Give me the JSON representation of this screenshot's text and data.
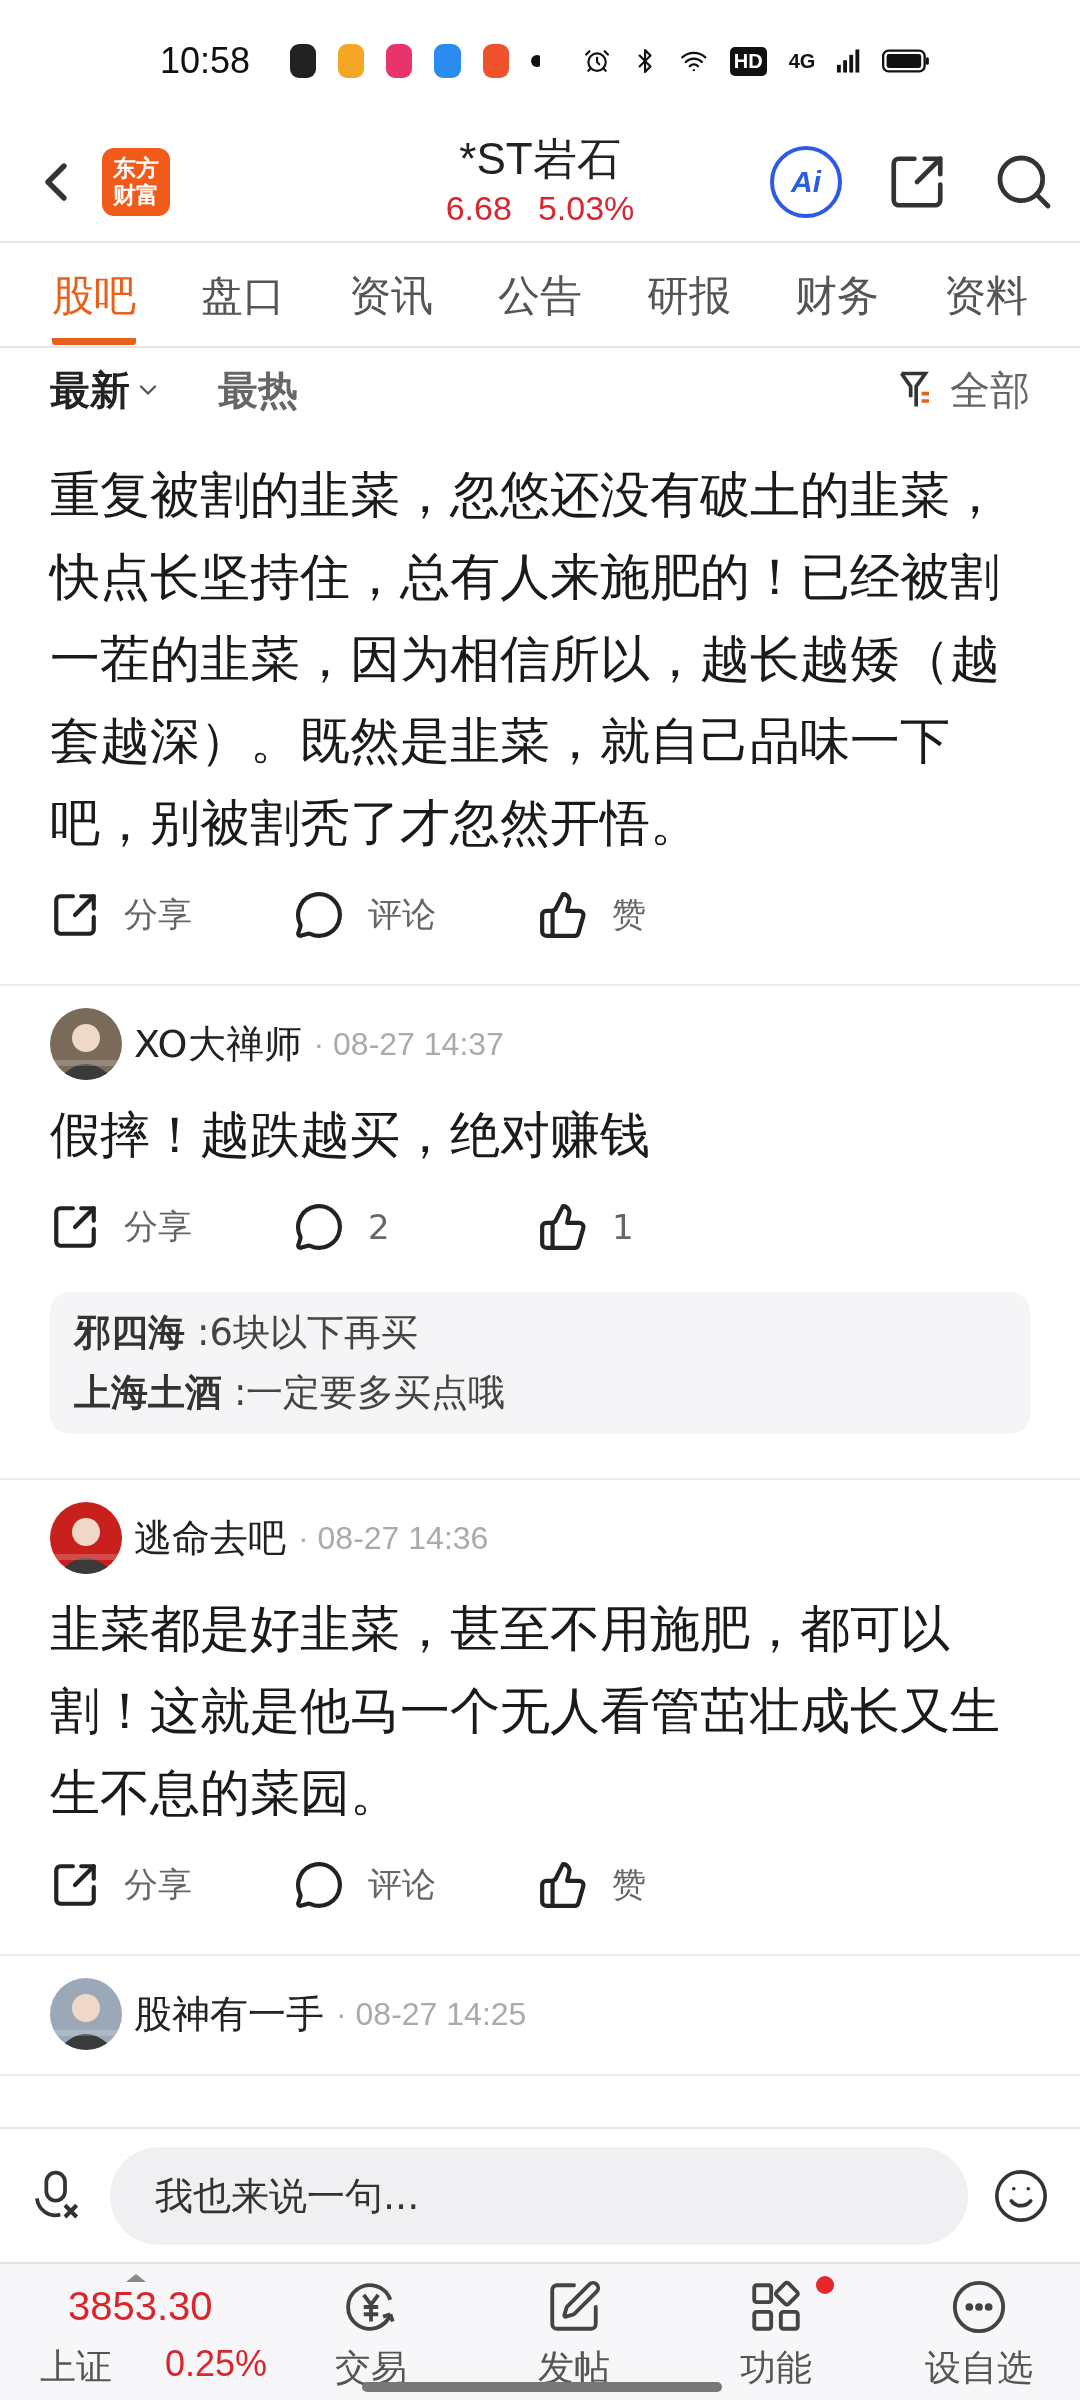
{
  "status_bar": {
    "time": "10:58",
    "hd": "HD",
    "network": "4G"
  },
  "header": {
    "logo_text": [
      "东方",
      "财富"
    ],
    "title": "*ST岩石",
    "price": "6.68",
    "change": "5.03%",
    "ai_label": "Ai"
  },
  "tabs": [
    {
      "label": "股吧",
      "selected": true
    },
    {
      "label": "盘口",
      "selected": false
    },
    {
      "label": "资讯",
      "selected": false
    },
    {
      "label": "公告",
      "selected": false
    },
    {
      "label": "研报",
      "selected": false
    },
    {
      "label": "财务",
      "selected": false
    },
    {
      "label": "资料",
      "selected": false
    }
  ],
  "sort_options": [
    {
      "label": "最新",
      "selected": true,
      "dropdown": true
    },
    {
      "label": "最热",
      "selected": false,
      "dropdown": false
    }
  ],
  "filter": {
    "label": "全部"
  },
  "posts": [
    {
      "text": "重复被割的韭菜，忽悠还没有破土的韭菜，快点长坚持住，总有人来施肥的！已经被割一茬的韭菜，因为相信所以，越长越矮（越套越深）。既然是韭菜，就自己品味一下吧，别被割秃了才忽然开悟。",
      "actions": [
        {
          "kind": "share",
          "label": "分享"
        },
        {
          "kind": "comment",
          "label": "评论"
        },
        {
          "kind": "like",
          "label": "赞"
        }
      ]
    },
    {
      "author": "XO大禅师",
      "time": "· 08-27 14:37",
      "avatar": {
        "kind": "picture"
      },
      "text": "假摔！越跌越买，绝对赚钱",
      "actions": [
        {
          "kind": "share",
          "label": "分享"
        },
        {
          "kind": "comment",
          "label": "2"
        },
        {
          "kind": "like",
          "label": "1"
        }
      ],
      "replies": [
        {
          "author": "邪四海",
          "text": ":6块以下再买"
        },
        {
          "author": "上海土酒",
          "text": ":一定要多买点哦"
        }
      ]
    },
    {
      "author": "逃命去吧",
      "time": "· 08-27 14:36",
      "avatar": {
        "kind": "picture"
      },
      "text": "韭菜都是好韭菜，甚至不用施肥，都可以割！这就是他马一个无人看管茁壮成长又生生不息的菜园。",
      "actions": [
        {
          "kind": "share",
          "label": "分享"
        },
        {
          "kind": "comment",
          "label": "评论"
        },
        {
          "kind": "like",
          "label": "赞"
        }
      ]
    },
    {
      "author": "股神有一手",
      "time": "· 08-27 14:25",
      "avatar": {
        "kind": "picture"
      }
    }
  ],
  "composer": {
    "placeholder": "我也来说一句..."
  },
  "index": {
    "value": "3853.30",
    "name": "上证",
    "change": "0.25%"
  },
  "nav": [
    {
      "kind": "trade",
      "label": "交易",
      "dot": false
    },
    {
      "kind": "post",
      "label": "发帖",
      "dot": false
    },
    {
      "kind": "feature",
      "label": "功能",
      "dot": true
    },
    {
      "kind": "watch",
      "label": "设自选",
      "dot": false
    }
  ]
}
